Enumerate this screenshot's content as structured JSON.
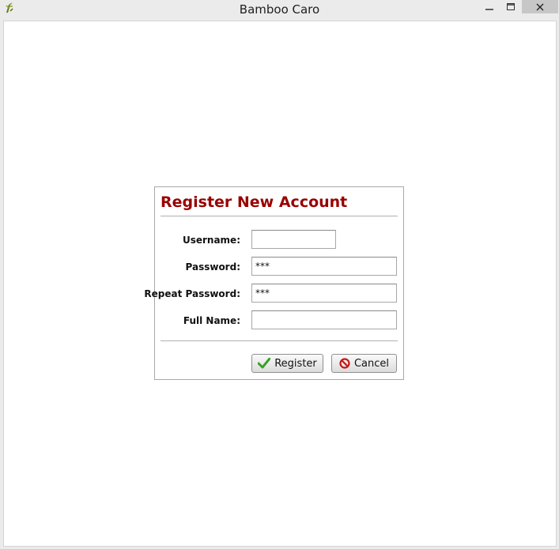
{
  "window": {
    "title": "Bamboo Caro"
  },
  "form": {
    "title": "Register New Account",
    "fields": {
      "username": {
        "label": "Username:",
        "value": ""
      },
      "password": {
        "label": "Password:",
        "value": "***"
      },
      "repeat_password": {
        "label": "Repeat Password:",
        "value": "***"
      },
      "full_name": {
        "label": "Full Name:",
        "value": ""
      }
    },
    "buttons": {
      "register": {
        "label": "Register",
        "icon": "checkmark-icon",
        "color": "#3aa12a"
      },
      "cancel": {
        "label": "Cancel",
        "icon": "no-entry-icon",
        "color": "#c41a1a"
      }
    }
  }
}
